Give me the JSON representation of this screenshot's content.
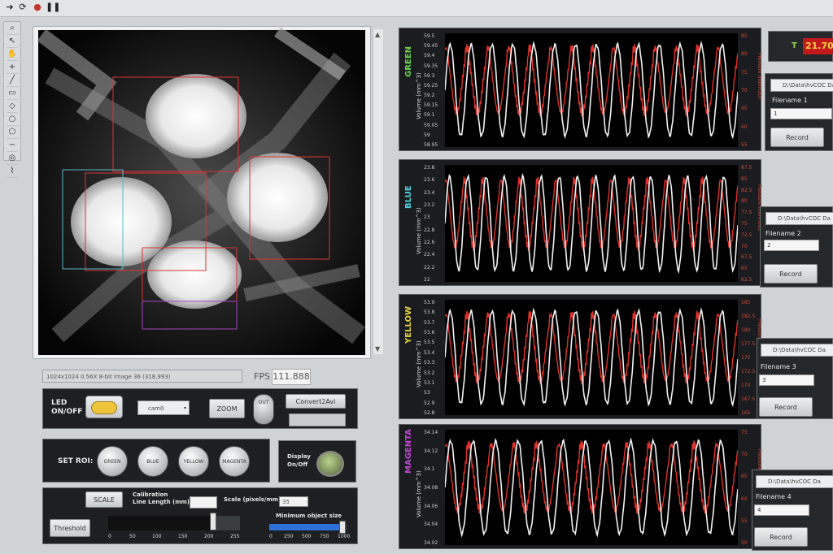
{
  "camera": {
    "status_text": "1024x1024 0.56X 8-bit image 36    (318,993)",
    "fps_label": "FPS",
    "fps_value": "111.888"
  },
  "controls": {
    "led_label": "LED\nON/OFF",
    "cam_select": "cam0",
    "zoom_label": "ZOOM",
    "out_label": "OUT",
    "convert_label": "Convert2Avi",
    "set_roi_label": "SET ROI:",
    "roi_buttons": [
      "GREEN",
      "BLUE",
      "YELLOW",
      "MAGENTA"
    ],
    "display_label": "Display\nOn/Off",
    "scale_button": "SCALE",
    "calibration_label": "Calibration\nLine Length (mm)",
    "scale_label": "Scale (pixels/mm)",
    "scale_value": "35",
    "threshold_button": "Threshold",
    "threshold_ticks": [
      "0",
      "50",
      "100",
      "150",
      "200",
      "255"
    ],
    "threshold_value": 0.8,
    "min_object_label": "Minimum object size",
    "min_object_ticks": [
      "0",
      "250",
      "500",
      "750",
      "1000"
    ],
    "min_object_value": 0.93
  },
  "plots": [
    {
      "channel": "GREEN",
      "color": "#6dd44b",
      "ylabel": "Volume (mm^3)",
      "rlabel": "Pressure (mmH2O)",
      "yticks": [
        "59.5",
        "59.45",
        "59.4",
        "59.35",
        "59.3",
        "59.25",
        "59.2",
        "59.15",
        "59.1",
        "59.05",
        "59",
        "58.95"
      ],
      "rticks": [
        "85",
        "80",
        "75",
        "70",
        "65",
        "60",
        "55"
      ],
      "cycles": 14
    },
    {
      "channel": "BLUE",
      "color": "#4fd0e6",
      "ylabel": "Volume (mm^3)",
      "rlabel": "Pressure (mmH2O)",
      "yticks": [
        "23.8",
        "23.6",
        "23.4",
        "23.2",
        "23",
        "22.8",
        "22.6",
        "22.4",
        "22.2",
        "22"
      ],
      "rticks": [
        "87.5",
        "85",
        "82.5",
        "80",
        "77.5",
        "75",
        "72.5",
        "70",
        "67.5",
        "65",
        "62.5"
      ],
      "cycles": 16
    },
    {
      "channel": "YELLOW",
      "color": "#e6d23a",
      "ylabel": "Volume (mm^3)",
      "rlabel": "Pressure (mmH2O)",
      "yticks": [
        "53.9",
        "53.8",
        "53.7",
        "53.6",
        "53.5",
        "53.4",
        "53.3",
        "53.2",
        "53.1",
        "53",
        "52.9",
        "52.8"
      ],
      "rticks": [
        "185",
        "182.5",
        "180",
        "177.5",
        "175",
        "172.5",
        "170",
        "167.5",
        "165"
      ],
      "cycles": 14
    },
    {
      "channel": "MAGENTA",
      "color": "#c246d6",
      "ylabel": "Volume (mm^3)",
      "rlabel": "Pressure (mmH2O)",
      "yticks": [
        "34.14",
        "34.12",
        "34.1",
        "34.08",
        "34.06",
        "34.04",
        "34.02"
      ],
      "rticks": [
        "75",
        "70",
        "65",
        "60",
        "55",
        "50"
      ],
      "cycles": 13
    }
  ],
  "temp": {
    "label": "T",
    "value": "21.70"
  },
  "recorders": [
    {
      "path": "D:\\Data\\hvCOC Da",
      "filename_label": "Filename 1",
      "filename_value": "1",
      "record_label": "Record"
    },
    {
      "path": "D:\\Data\\hvCOC Da",
      "filename_label": "Filename 2",
      "filename_value": "2",
      "record_label": "Record"
    },
    {
      "path": "D:\\Data\\hvCOC Da",
      "filename_label": "Filename 3",
      "filename_value": "3",
      "record_label": "Record"
    },
    {
      "path": "D:\\Data\\hvCOC Da",
      "filename_label": "Filename 4",
      "filename_value": "4",
      "record_label": "Record"
    }
  ],
  "icons": [
    "run-arrow-icon",
    "run-continuous-icon",
    "abort-icon",
    "pause-icon",
    "zoom-tool-icon",
    "pointer-tool-icon",
    "hand-tool-icon",
    "crosshair-tool-icon",
    "line-tool-icon",
    "rect-tool-icon",
    "rotated-rect-tool-icon",
    "oval-tool-icon",
    "polygon-tool-icon",
    "freehand-tool-icon",
    "annulus-tool-icon",
    "broken-line-tool-icon"
  ]
}
